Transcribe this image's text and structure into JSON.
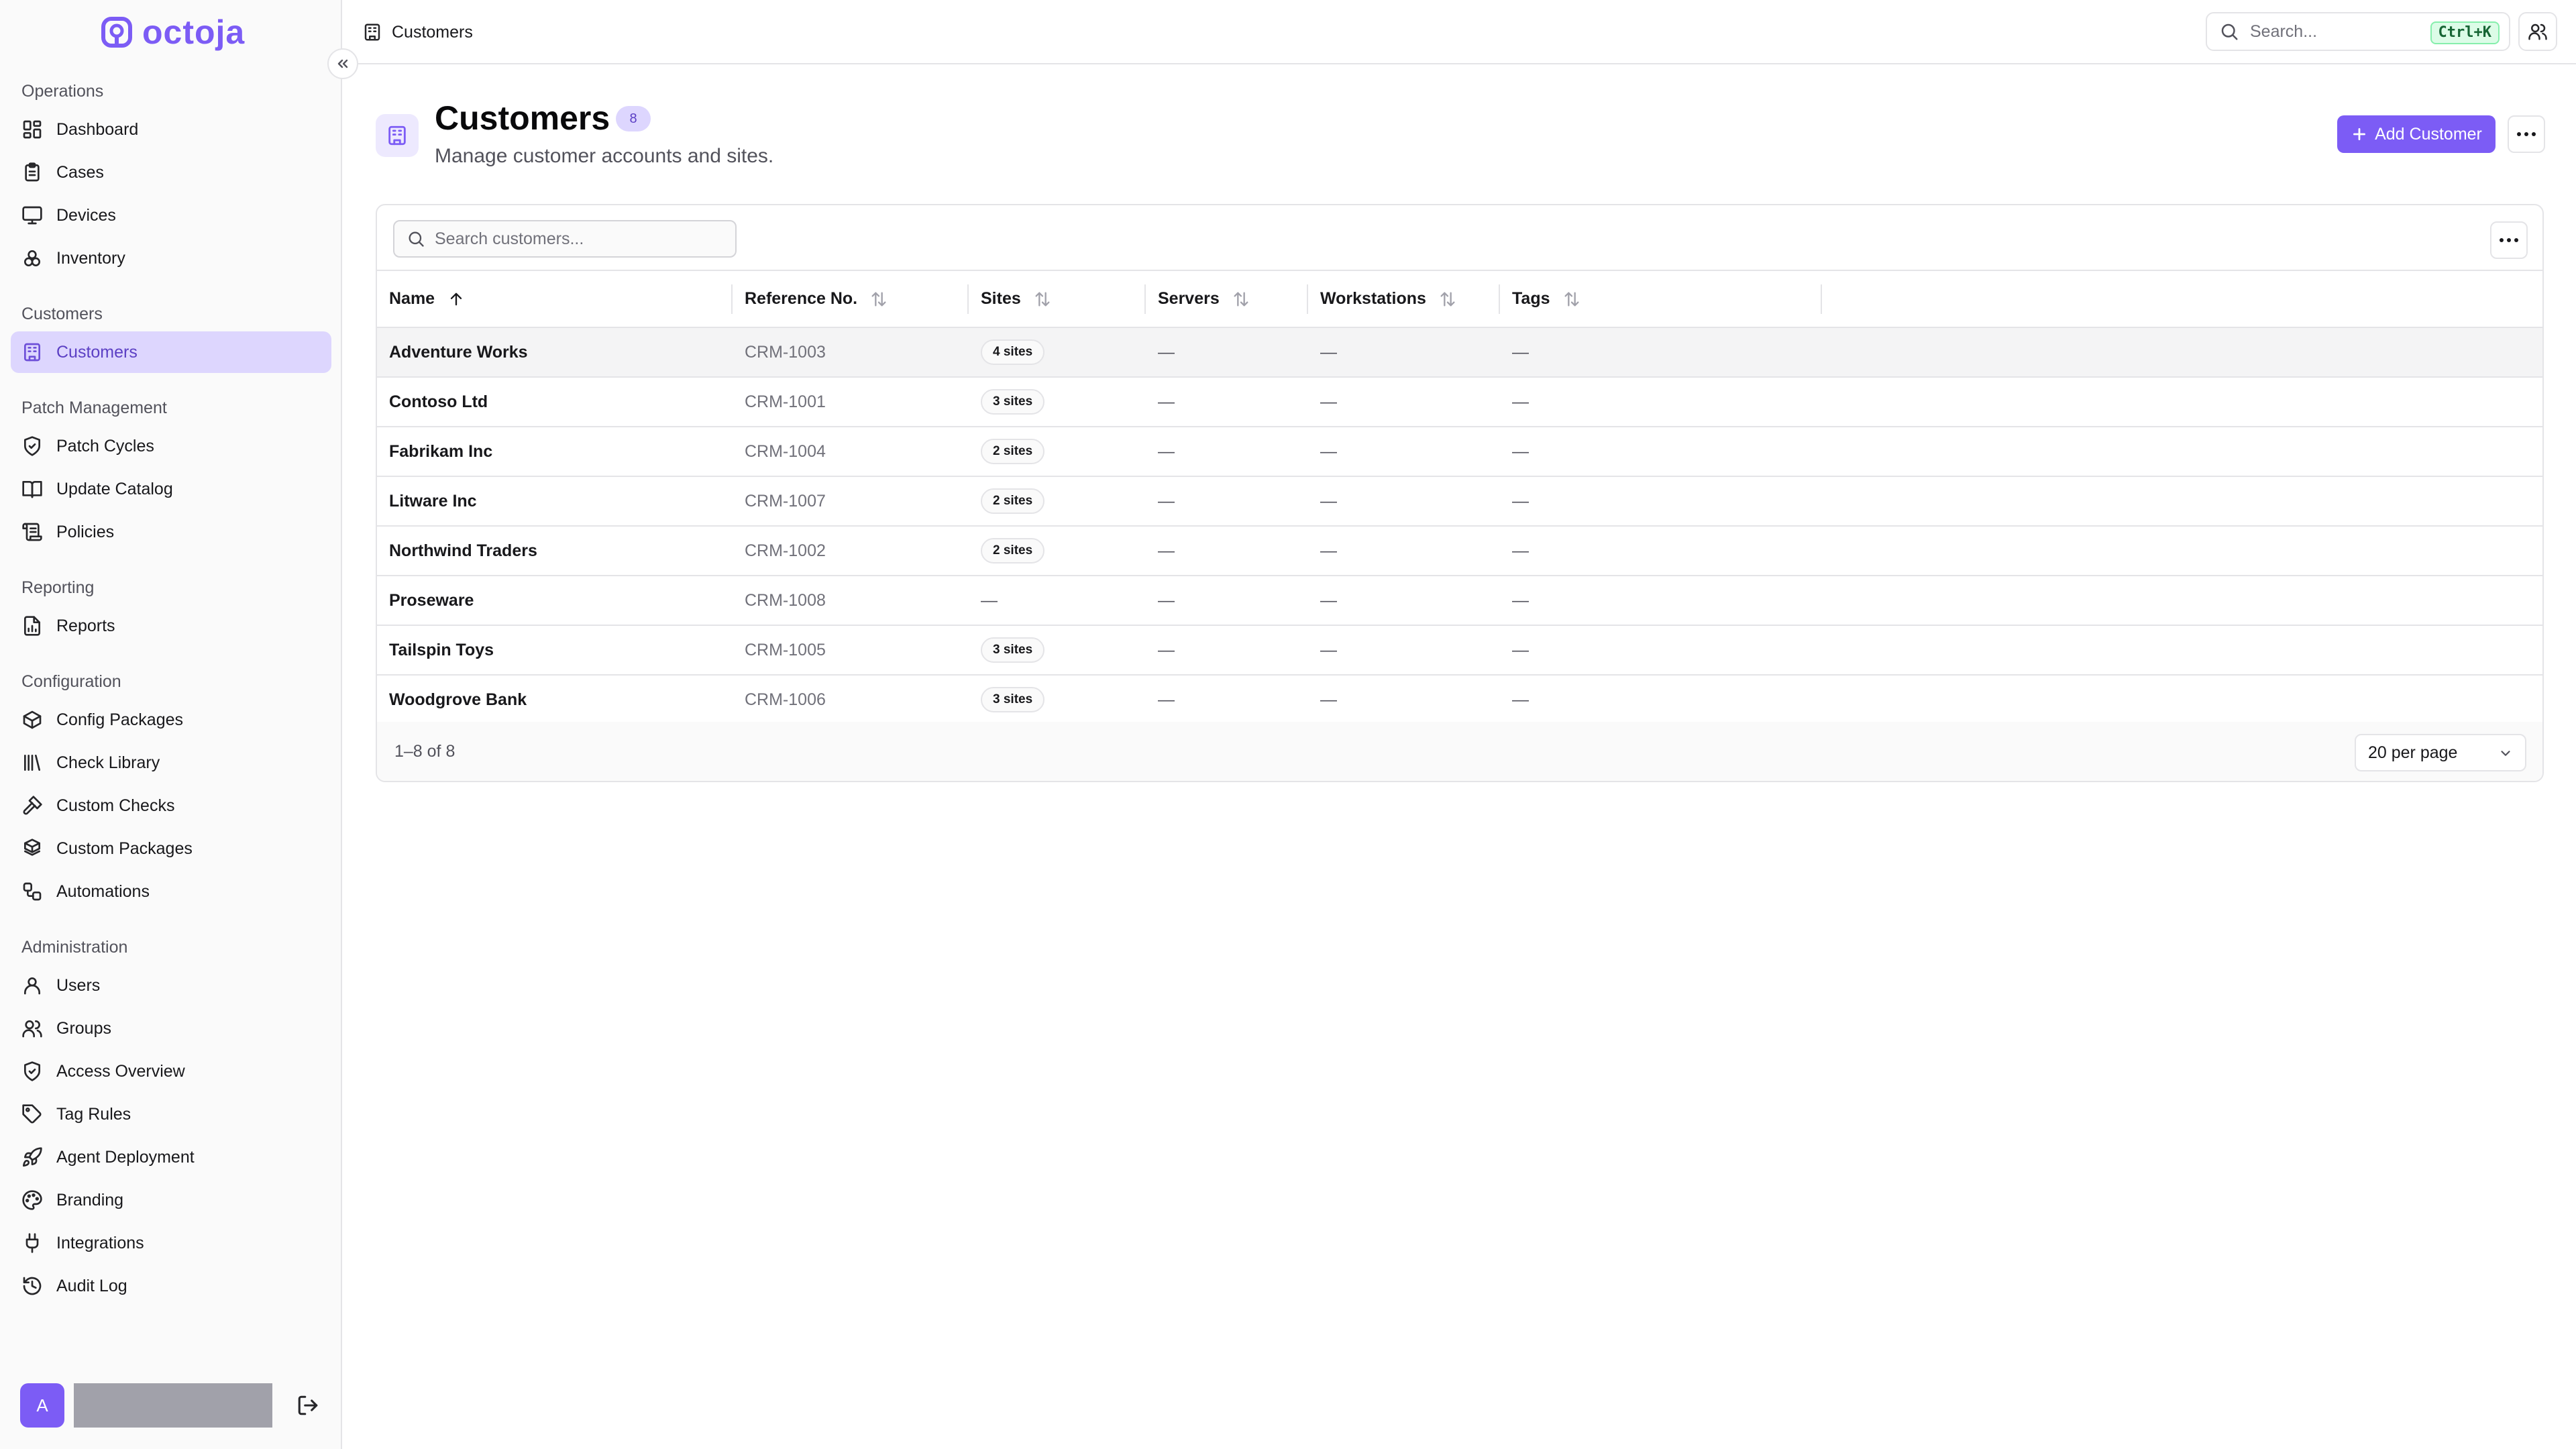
{
  "app": {
    "name": "octoja",
    "accent": "#7c5cf5"
  },
  "sidebar": {
    "sections": [
      {
        "heading": "Operations",
        "items": [
          {
            "label": "Dashboard",
            "icon": "dashboard-icon"
          },
          {
            "label": "Cases",
            "icon": "clipboard-icon"
          },
          {
            "label": "Devices",
            "icon": "monitor-icon"
          },
          {
            "label": "Inventory",
            "icon": "boxes-icon"
          }
        ]
      },
      {
        "heading": "Customers",
        "items": [
          {
            "label": "Customers",
            "icon": "building-icon",
            "active": true
          }
        ]
      },
      {
        "heading": "Patch Management",
        "items": [
          {
            "label": "Patch Cycles",
            "icon": "shield-check-icon"
          },
          {
            "label": "Update Catalog",
            "icon": "book-icon"
          },
          {
            "label": "Policies",
            "icon": "scroll-icon"
          }
        ]
      },
      {
        "heading": "Reporting",
        "items": [
          {
            "label": "Reports",
            "icon": "report-icon"
          }
        ]
      },
      {
        "heading": "Configuration",
        "items": [
          {
            "label": "Config Packages",
            "icon": "package-icon"
          },
          {
            "label": "Check Library",
            "icon": "library-icon"
          },
          {
            "label": "Custom Checks",
            "icon": "hammer-icon"
          },
          {
            "label": "Custom Packages",
            "icon": "packages-icon"
          },
          {
            "label": "Automations",
            "icon": "workflow-icon"
          }
        ]
      },
      {
        "heading": "Administration",
        "items": [
          {
            "label": "Users",
            "icon": "user-icon"
          },
          {
            "label": "Groups",
            "icon": "users-icon"
          },
          {
            "label": "Access Overview",
            "icon": "shield-icon"
          },
          {
            "label": "Tag Rules",
            "icon": "tag-icon"
          },
          {
            "label": "Agent Deployment",
            "icon": "rocket-icon"
          },
          {
            "label": "Branding",
            "icon": "palette-icon"
          },
          {
            "label": "Integrations",
            "icon": "plug-icon"
          },
          {
            "label": "Audit Log",
            "icon": "history-icon"
          }
        ]
      }
    ],
    "user_initial": "A"
  },
  "header": {
    "breadcrumb": "Customers",
    "search_placeholder": "Search...",
    "search_shortcut": "Ctrl+K"
  },
  "page": {
    "title": "Customers",
    "count": "8",
    "subtitle": "Manage customer accounts and sites.",
    "add_label": "Add Customer"
  },
  "table": {
    "search_placeholder": "Search customers...",
    "columns": [
      "Name",
      "Reference No.",
      "Sites",
      "Servers",
      "Workstations",
      "Tags"
    ],
    "rows": [
      {
        "name": "Adventure Works",
        "ref": "CRM-1003",
        "sites": "4 sites",
        "servers": "—",
        "workstations": "—",
        "tags": "—"
      },
      {
        "name": "Contoso Ltd",
        "ref": "CRM-1001",
        "sites": "3 sites",
        "servers": "—",
        "workstations": "—",
        "tags": "—"
      },
      {
        "name": "Fabrikam Inc",
        "ref": "CRM-1004",
        "sites": "2 sites",
        "servers": "—",
        "workstations": "—",
        "tags": "—"
      },
      {
        "name": "Litware Inc",
        "ref": "CRM-1007",
        "sites": "2 sites",
        "servers": "—",
        "workstations": "—",
        "tags": "—"
      },
      {
        "name": "Northwind Traders",
        "ref": "CRM-1002",
        "sites": "2 sites",
        "servers": "—",
        "workstations": "—",
        "tags": "—"
      },
      {
        "name": "Proseware",
        "ref": "CRM-1008",
        "sites": "—",
        "servers": "—",
        "workstations": "—",
        "tags": "—"
      },
      {
        "name": "Tailspin Toys",
        "ref": "CRM-1005",
        "sites": "3 sites",
        "servers": "—",
        "workstations": "—",
        "tags": "—"
      },
      {
        "name": "Woodgrove Bank",
        "ref": "CRM-1006",
        "sites": "3 sites",
        "servers": "—",
        "workstations": "—",
        "tags": "—"
      }
    ],
    "range_text": "1–8 of 8",
    "per_page": "20 per page"
  }
}
